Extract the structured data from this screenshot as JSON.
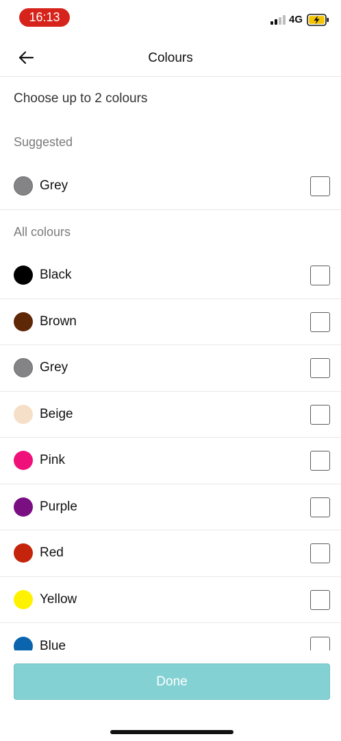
{
  "status_bar": {
    "time": "16:13",
    "network": "4G",
    "icons": [
      "signal-icon",
      "battery-charging-icon"
    ]
  },
  "header": {
    "title": "Colours",
    "back_icon": "arrow-left-icon"
  },
  "instruction": "Choose up to 2 colours",
  "suggested": {
    "label": "Suggested",
    "items": [
      {
        "label": "Grey",
        "color": "#848385",
        "checked": false
      }
    ]
  },
  "all_colours": {
    "label": "All colours",
    "items": [
      {
        "label": "Black",
        "color": "#000000",
        "checked": false
      },
      {
        "label": "Brown",
        "color": "#5e2706",
        "checked": false
      },
      {
        "label": "Grey",
        "color": "#848385",
        "checked": false
      },
      {
        "label": "Beige",
        "color": "#f6dfc8",
        "checked": false
      },
      {
        "label": "Pink",
        "color": "#f0107a",
        "checked": false
      },
      {
        "label": "Purple",
        "color": "#7a0f82",
        "checked": false
      },
      {
        "label": "Red",
        "color": "#c4240b",
        "checked": false
      },
      {
        "label": "Yellow",
        "color": "#fff200",
        "checked": false
      },
      {
        "label": "Blue",
        "color": "#0a64ae",
        "checked": false
      }
    ]
  },
  "done_button": {
    "label": "Done",
    "color": "#84d1d4"
  }
}
